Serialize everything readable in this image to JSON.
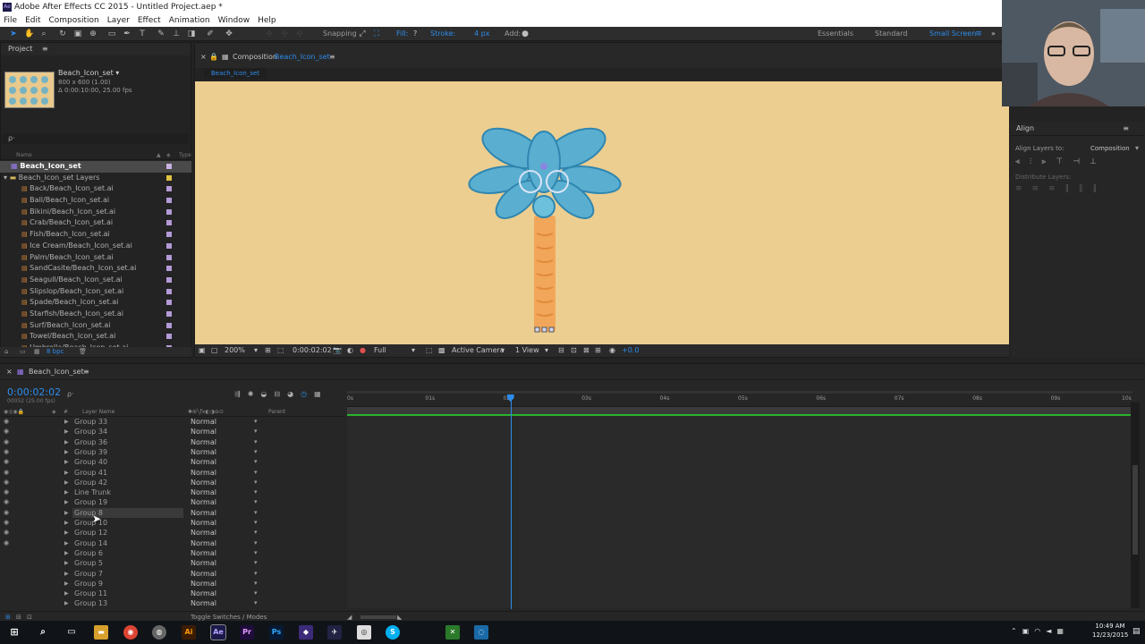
{
  "app": {
    "title": "Adobe After Effects CC 2015 - Untitled Project.aep *",
    "logo": "Ae",
    "menu": [
      "File",
      "Edit",
      "Composition",
      "Layer",
      "Effect",
      "Animation",
      "Window",
      "Help"
    ]
  },
  "toolbar": {
    "snapping": "Snapping",
    "fill": "Fill:",
    "fill_value": "?",
    "stroke": "Stroke:",
    "stroke_px": "4 px",
    "add": "Add:",
    "workspaces": [
      "Essentials",
      "Standard",
      "Small Screen"
    ],
    "active_workspace": "Small Screen",
    "more": "»"
  },
  "project": {
    "tab": "Project",
    "comp_name": "Beach_Icon_set",
    "comp_size": "800 x 600 (1.00)",
    "comp_duration": "Δ 0:00:10:00, 25.00 fps",
    "search_placeholder": "ρ·",
    "col_name": "Name",
    "col_type": "Type",
    "root": "Beach_Icon_set",
    "folder": "Beach_Icon_set Layers",
    "files": [
      "Back/Beach_Icon_set.ai",
      "Ball/Beach_Icon_set.ai",
      "Bikini/Beach_Icon_set.ai",
      "Crab/Beach_Icon_set.ai",
      "Fish/Beach_Icon_set.ai",
      "Ice Cream/Beach_Icon_set.ai",
      "Palm/Beach_Icon_set.ai",
      "SandCasite/Beach_Icon_set.ai",
      "Seagull/Beach_Icon_set.ai",
      "Slipslop/Beach_Icon_set.ai",
      "Spade/Beach_Icon_set.ai",
      "Starfish/Beach_Icon_set.ai",
      "Surf/Beach_Icon_set.ai",
      "Towel/Beach_Icon_set.ai",
      "Umbrella/Beach_Icon_set.ai"
    ],
    "bpc": "8 bpc"
  },
  "composition": {
    "panel_label": "Composition",
    "panel_name": "Beach_Icon_set",
    "tab": "Beach_Icon_set",
    "zoom": "200%",
    "timecode": "0:00:02:02",
    "resolution": "Full",
    "camera": "Active Camera",
    "view": "1 View",
    "exposure": "+0.0"
  },
  "align": {
    "title": "Align",
    "align_to_label": "Align Layers to:",
    "align_to_value": "Composition",
    "distribute": "Distribute Layers:"
  },
  "timeline": {
    "tab": "Beach_Icon_set",
    "timecode": "0:00:02:02",
    "frame_info": "00052 (25.00 fps)",
    "col_num": "#",
    "col_name": "Layer Name",
    "col_parent": "Parent",
    "rulers": [
      "0s",
      "01s",
      "02s",
      "03s",
      "04s",
      "05s",
      "06s",
      "07s",
      "08s",
      "09s",
      "10s"
    ],
    "playhead_fraction": 0.208,
    "layers": [
      {
        "name": "Group 33",
        "mode": "Normal"
      },
      {
        "name": "Group 34",
        "mode": "Normal"
      },
      {
        "name": "Group 36",
        "mode": "Normal"
      },
      {
        "name": "Group 39",
        "mode": "Normal"
      },
      {
        "name": "Group 40",
        "mode": "Normal"
      },
      {
        "name": "Group 41",
        "mode": "Normal"
      },
      {
        "name": "Group 42",
        "mode": "Normal"
      },
      {
        "name": "Line Trunk",
        "mode": "Normal"
      },
      {
        "name": "Group 19",
        "mode": "Normal"
      },
      {
        "name": "Group 8",
        "mode": "Normal"
      },
      {
        "name": "Group 10",
        "mode": "Normal"
      },
      {
        "name": "Group 12",
        "mode": "Normal"
      },
      {
        "name": "Group 14",
        "mode": "Normal"
      },
      {
        "name": "Group 6",
        "mode": "Normal"
      },
      {
        "name": "Group 5",
        "mode": "Normal"
      },
      {
        "name": "Group 7",
        "mode": "Normal"
      },
      {
        "name": "Group 9",
        "mode": "Normal"
      },
      {
        "name": "Group 11",
        "mode": "Normal"
      },
      {
        "name": "Group 13",
        "mode": "Normal"
      }
    ],
    "toggle": "Toggle Switches / Modes"
  },
  "taskbar": {
    "time": "10:49 AM",
    "date": "12/23/2015",
    "apps": [
      "Ai",
      "Ae",
      "Pr",
      "Ps"
    ]
  },
  "colors": {
    "accent": "#2d8ceb",
    "canvas": "#ecce90",
    "palm_leaf": "#5aaed0",
    "palm_trunk": "#f2a65a"
  }
}
